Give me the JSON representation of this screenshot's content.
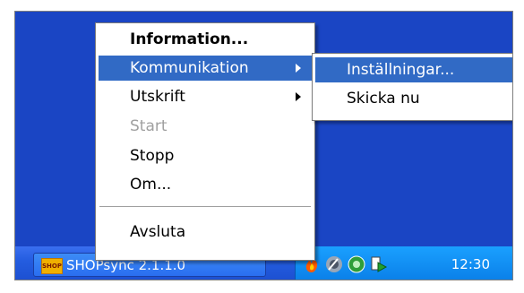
{
  "context_menu": {
    "items": [
      {
        "label": "Information..."
      },
      {
        "label": "Kommunikation"
      },
      {
        "label": "Utskrift"
      },
      {
        "label": "Start"
      },
      {
        "label": "Stopp"
      },
      {
        "label": "Om..."
      },
      {
        "label": "Avsluta"
      }
    ]
  },
  "submenu": {
    "items": [
      {
        "label": "Inställningar..."
      },
      {
        "label": "Skicka nu"
      }
    ]
  },
  "taskbar": {
    "task_button": {
      "label": "SHOPsync 2.1.1.0",
      "icon": "shop-app-icon",
      "icon_text": "SHOP"
    },
    "tray_icons": [
      "flame-icon",
      "speaker-icon",
      "network-icon",
      "media-icon"
    ],
    "clock": "12:30"
  },
  "colors": {
    "desktop": "#1a45c4",
    "menu_highlight": "#316ac5",
    "taskbar": "#245de0",
    "tray": "#0a7fe8"
  }
}
